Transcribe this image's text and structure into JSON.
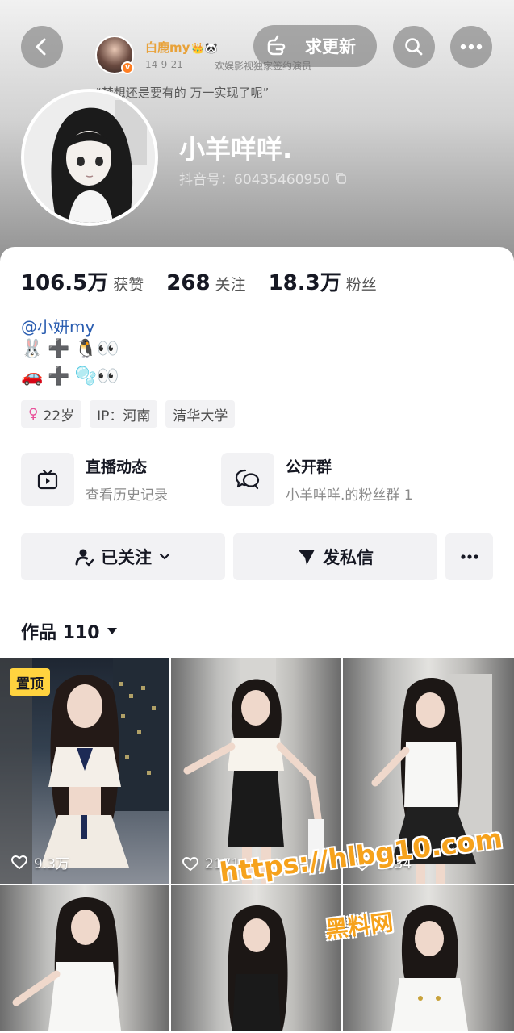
{
  "header": {
    "update_button_label": "求更新",
    "mini_profile": {
      "name": "白鹿my",
      "name_emojis": "👑🐼",
      "date": "14-9-21",
      "description": "欢娱影视独家签约演员"
    },
    "quote": "“梦想还是要有的 万一实现了呢”",
    "username": "小羊咩咩.",
    "douyin_id": "抖音号：60435460950"
  },
  "stats": [
    {
      "value": "106.5万",
      "label": "获赞"
    },
    {
      "value": "268",
      "label": "关注"
    },
    {
      "value": "18.3万",
      "label": "粉丝"
    }
  ],
  "bio": {
    "mention": "@小妍my",
    "line1": {
      "a": "🐰",
      "plus": "➕",
      "b": "🐧👀"
    },
    "line2": {
      "a": "🚗",
      "plus": "➕",
      "b": "🫧👀"
    }
  },
  "tags": {
    "age_icon": "♀",
    "age": "22岁",
    "ip": "IP：河南",
    "school": "清华大学"
  },
  "entries": {
    "live": {
      "title": "直播动态",
      "subtitle": "查看历史记录"
    },
    "group": {
      "title": "公开群",
      "subtitle": "小羊咩咩.的粉丝群 1"
    }
  },
  "actions": {
    "follow_label": "已关注",
    "message_label": "发私信"
  },
  "works_tab": {
    "label": "作品 110"
  },
  "videos": [
    {
      "likes": "9.3万",
      "pinned_label": "置顶"
    },
    {
      "likes": "2171"
    },
    {
      "likes": "1834"
    }
  ],
  "watermark": {
    "url": "https://hlbg10.com",
    "name": "黑料网"
  },
  "colors": {
    "accent_follow_bg": "#f2f2f4",
    "pin_badge": "#ffd33f",
    "watermark": "#f6a21c"
  }
}
